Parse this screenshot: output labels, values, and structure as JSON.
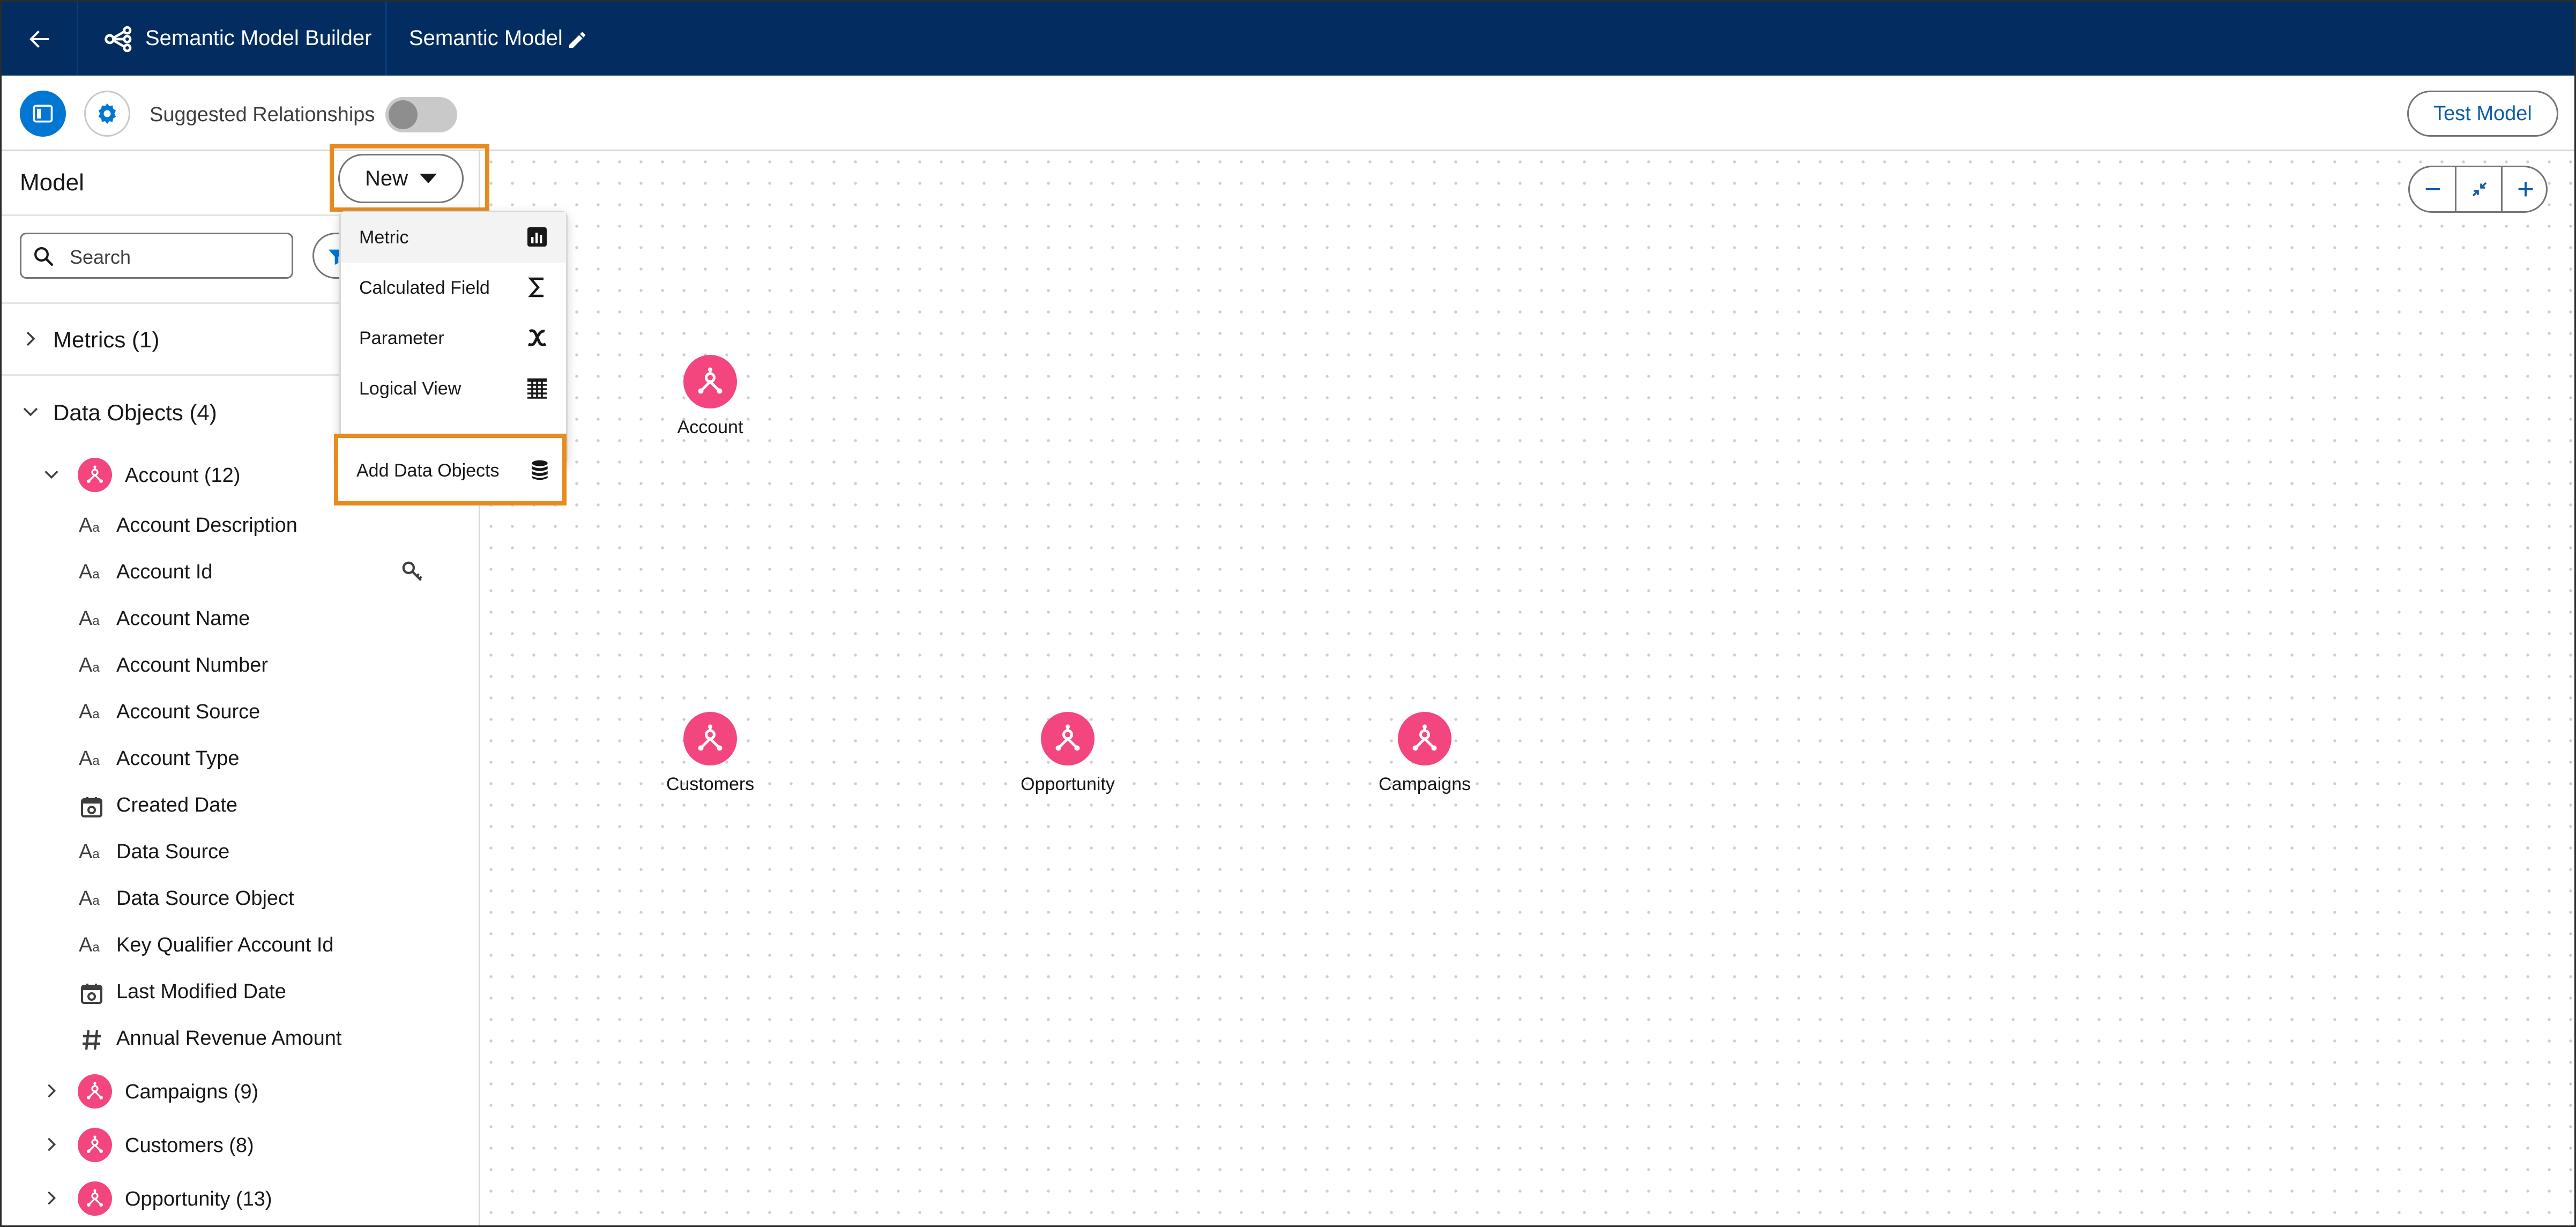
{
  "app": {
    "title": "Semantic Model Builder",
    "model_name": "Semantic Model"
  },
  "toolbar": {
    "suggested_relationships_label": "Suggested Relationships",
    "suggested_relationships_on": false,
    "test_model_label": "Test Model"
  },
  "sidebar": {
    "title": "Model",
    "search_placeholder": "Search",
    "metrics_label": "Metrics (1)",
    "data_objects_label": "Data Objects (4)",
    "objects": [
      {
        "label": "Account (12)",
        "expanded": true
      },
      {
        "label": "Campaigns (9)",
        "expanded": false
      },
      {
        "label": "Customers (8)",
        "expanded": false
      },
      {
        "label": "Opportunity (13)",
        "expanded": false
      }
    ],
    "account_fields": [
      {
        "label": "Account Description",
        "type": "text"
      },
      {
        "label": "Account Id",
        "type": "text",
        "key": true
      },
      {
        "label": "Account Name",
        "type": "text"
      },
      {
        "label": "Account Number",
        "type": "text"
      },
      {
        "label": "Account Source",
        "type": "text"
      },
      {
        "label": "Account Type",
        "type": "text"
      },
      {
        "label": "Created Date",
        "type": "date"
      },
      {
        "label": "Data Source",
        "type": "text"
      },
      {
        "label": "Data Source Object",
        "type": "text"
      },
      {
        "label": "Key Qualifier Account Id",
        "type": "text"
      },
      {
        "label": "Last Modified Date",
        "type": "date"
      },
      {
        "label": "Annual Revenue Amount",
        "type": "number"
      }
    ]
  },
  "new_menu": {
    "button_label": "New",
    "items": [
      {
        "label": "Metric",
        "icon": "bar-chart-icon"
      },
      {
        "label": "Calculated Field",
        "icon": "sigma-icon"
      },
      {
        "label": "Parameter",
        "icon": "variable-x-icon"
      },
      {
        "label": "Logical View",
        "icon": "table-grid-icon"
      }
    ],
    "add_data_objects_label": "Add Data Objects"
  },
  "canvas": {
    "nodes": [
      {
        "label": "Account"
      },
      {
        "label": "Customers"
      },
      {
        "label": "Opportunity"
      },
      {
        "label": "Campaigns"
      }
    ]
  },
  "colors": {
    "header_bg": "#032d60",
    "brand_blue": "#0176d3",
    "object_pink": "#f3467e",
    "highlight_orange": "#e88b1f"
  }
}
